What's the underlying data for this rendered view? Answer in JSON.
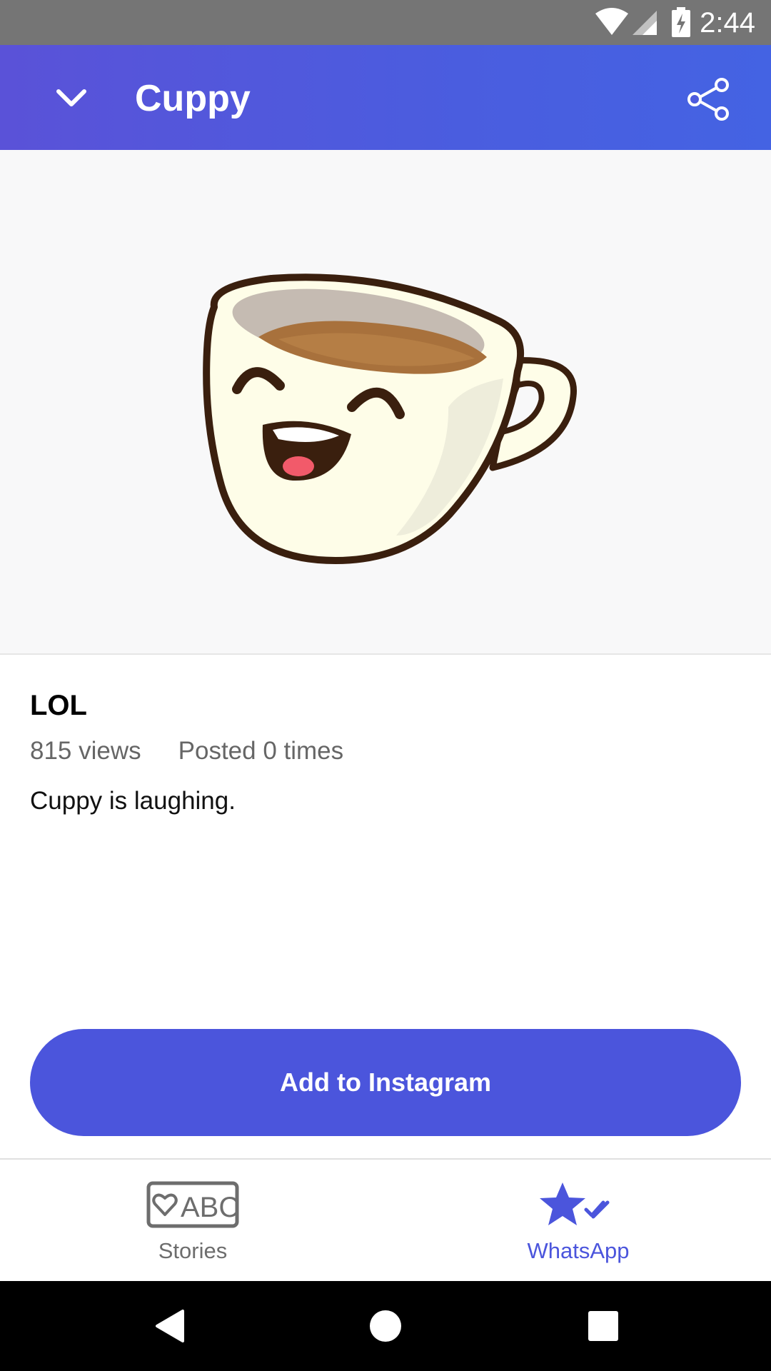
{
  "status_bar": {
    "time": "2:44"
  },
  "app_bar": {
    "title": "Cuppy"
  },
  "sticker": {
    "name": "LOL",
    "views": "815 views",
    "posted": "Posted 0 times",
    "description": "Cuppy is laughing."
  },
  "actions": {
    "add_button": "Add to Instagram"
  },
  "bottom_nav": {
    "items": [
      {
        "label": "Stories",
        "icon": "heart-abc-icon",
        "active": false
      },
      {
        "label": "WhatsApp",
        "icon": "star-check-icon",
        "active": true
      }
    ]
  },
  "colors": {
    "accent": "#4b55dc",
    "header_gradient_start": "#5a52d8",
    "header_gradient_end": "#4463e3",
    "status_bar": "#757575",
    "inactive_nav": "#6d6d6d"
  },
  "icons": {
    "back": "chevron-down-icon",
    "share": "share-icon",
    "wifi": "wifi-icon",
    "signal": "signal-icon",
    "battery": "battery-charging-icon",
    "sys_back": "triangle-back-icon",
    "sys_home": "circle-home-icon",
    "sys_recents": "square-recents-icon"
  }
}
